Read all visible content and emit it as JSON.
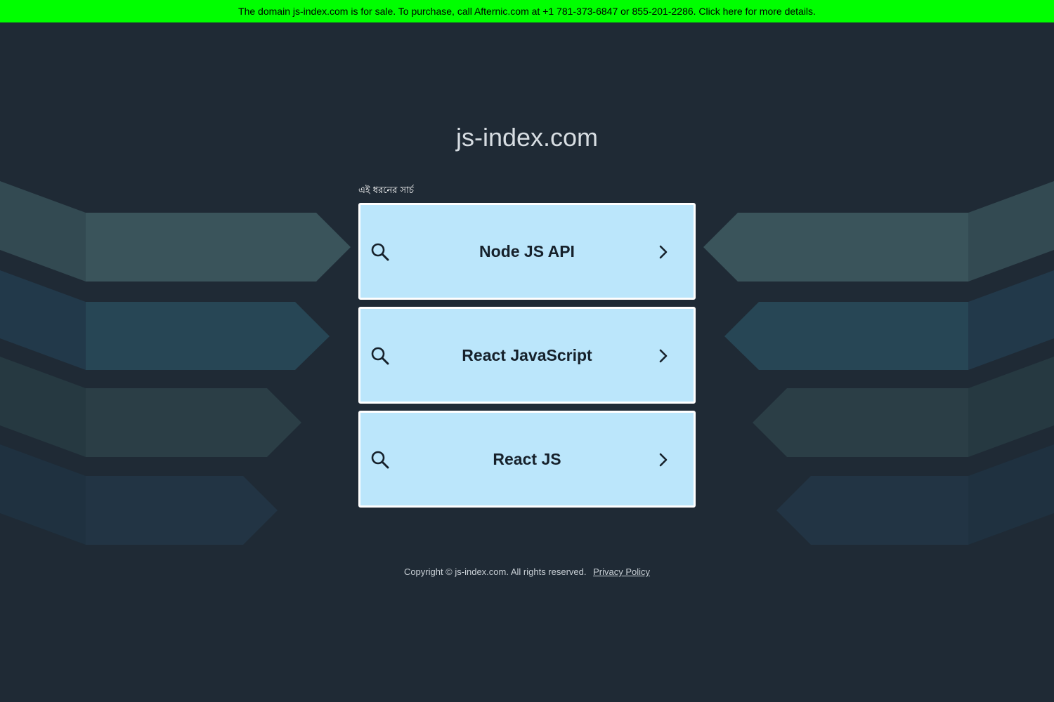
{
  "banner": {
    "text": "The domain js-index.com is for sale. To purchase, call Afternic.com at +1 781-373-6847 or 855-201-2286. Click here for more details."
  },
  "site": {
    "title": "js-index.com"
  },
  "search": {
    "heading": "এই ধরনের সার্চ",
    "results": [
      {
        "label": "Node JS API"
      },
      {
        "label": "React JavaScript"
      },
      {
        "label": "React JS"
      }
    ]
  },
  "footer": {
    "copyright": "Copyright © js-index.com.  All rights reserved.",
    "privacy": "Privacy Policy"
  },
  "colors": {
    "banner_bg": "#00ff00",
    "page_bg": "#1f2a35",
    "card_bg": "#bbe6fb",
    "card_border": "#ffffff"
  },
  "icons": {
    "search": "search-icon",
    "chevron": "chevron-right-icon"
  }
}
